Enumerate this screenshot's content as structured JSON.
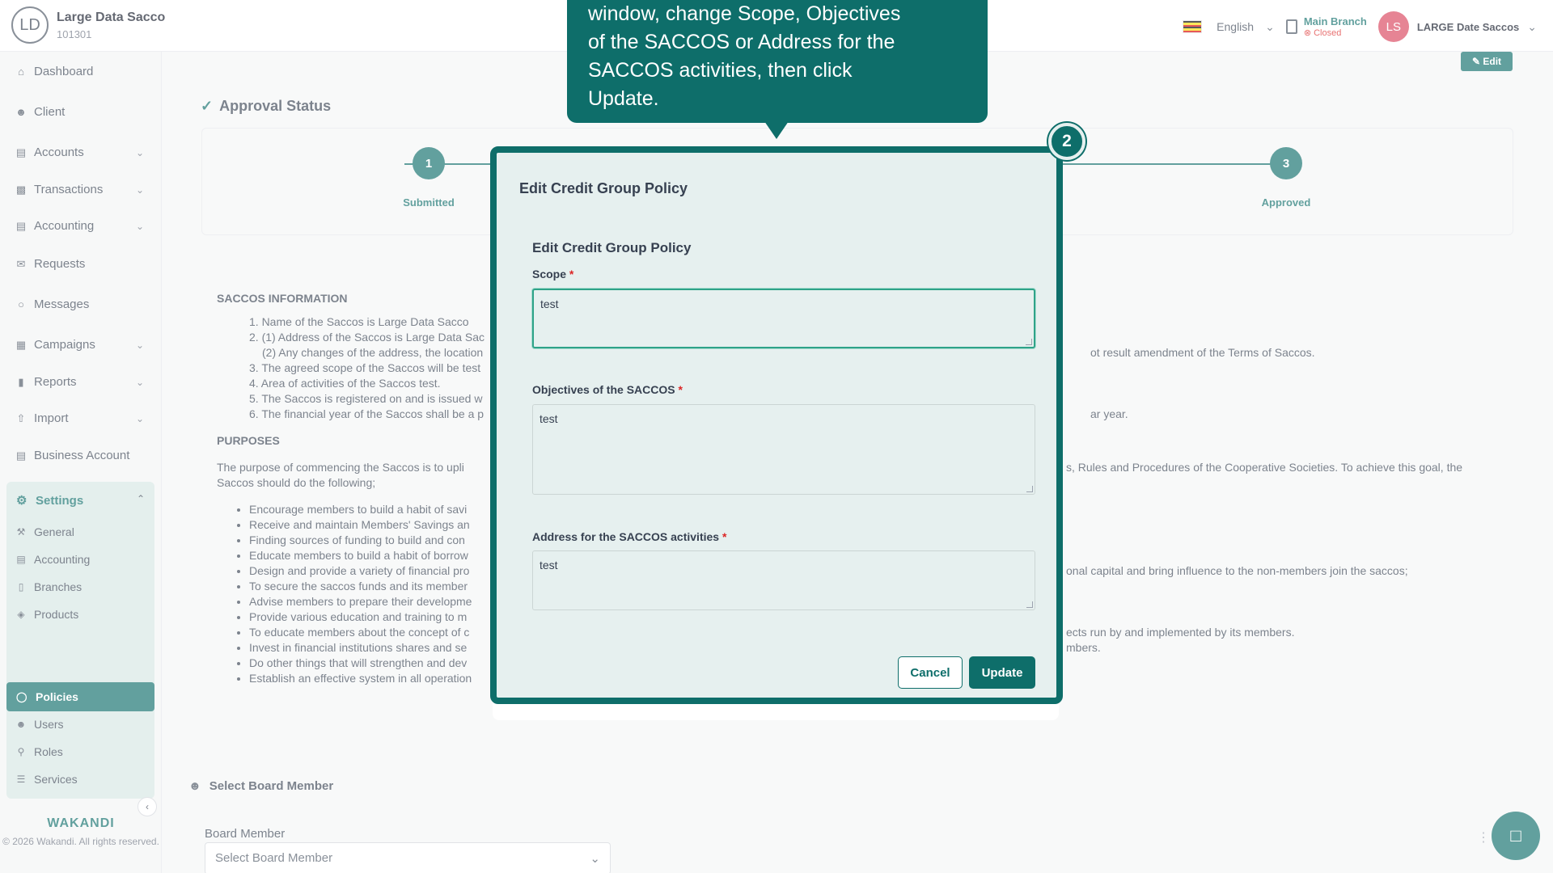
{
  "header": {
    "org_initials": "LD",
    "org_name": "Large Data Sacco",
    "org_code": "101301",
    "language": "English",
    "branch_name": "Main Branch",
    "branch_status": "Closed",
    "user_initials": "LS",
    "user_name": "LARGE Date Saccos"
  },
  "sidebar": {
    "items": [
      {
        "label": "Dashboard",
        "icon": "home-icon"
      },
      {
        "label": "Client",
        "icon": "user-icon"
      },
      {
        "label": "Accounts",
        "icon": "bank-icon"
      },
      {
        "label": "Transactions",
        "icon": "transactions-icon"
      },
      {
        "label": "Accounting",
        "icon": "ledger-icon"
      },
      {
        "label": "Requests",
        "icon": "mail-icon"
      },
      {
        "label": "Messages",
        "icon": "message-icon"
      },
      {
        "label": "Campaigns",
        "icon": "grid-icon"
      },
      {
        "label": "Reports",
        "icon": "chart-icon"
      },
      {
        "label": "Import",
        "icon": "upload-icon"
      },
      {
        "label": "Business Account",
        "icon": "bank-icon"
      }
    ],
    "settings_label": "Settings",
    "settings_items": [
      {
        "label": "General"
      },
      {
        "label": "Accounting"
      },
      {
        "label": "Branches"
      },
      {
        "label": "Products"
      },
      {
        "label": "Policies"
      },
      {
        "label": "Users"
      },
      {
        "label": "Roles"
      },
      {
        "label": "Services"
      }
    ],
    "brand": "WAKANDI",
    "copyright": "© 2026 Wakandi. All rights reserved."
  },
  "page": {
    "edit_label": "Edit",
    "approval_title": "Approval Status",
    "steps": [
      {
        "number": "1",
        "label": "Submitted"
      },
      {
        "number": "3",
        "label": "Approved"
      }
    ],
    "info_heading": "SACCOS INFORMATION",
    "info_items": [
      "1. Name of the Saccos is Large Data Sacco",
      "2. (1) Address of the Saccos is Large Data Sac",
      "(2) Any changes of the address, the location",
      "ot result amendment of the Terms of Saccos.",
      "3. The agreed scope of the Saccos will be test",
      "4. Area of activities of the Saccos test.",
      "5. The Saccos is registered on and is issued w",
      "6. The financial year of the Saccos shall be a p",
      "ar year."
    ],
    "purposes_heading": "PURPOSES",
    "purposes_intro_left": "The purpose of commencing the Saccos is to upli",
    "purposes_intro_right": "s, Rules and Procedures of the Cooperative Societies. To achieve this goal, the",
    "purposes_intro_2": "Saccos should do the following;",
    "purposes": [
      "Encourage members to build a habit of savi",
      "Receive and maintain Members' Savings an",
      "Finding sources of funding to build and con",
      "Educate members to build a habit of borrow",
      "Design and provide a variety of financial pro",
      "To secure the saccos funds and its member",
      "Advise members to prepare their developme",
      "Provide various education and training to m",
      "To educate members about the concept of c",
      "Invest in financial institutions shares and se",
      "Do other things that will strengthen and dev",
      "Establish an effective system in all operation"
    ],
    "purposes_right": [
      "onal capital and bring influence to the non-members join the saccos;",
      "ects run by and implemented by its members.",
      "mbers."
    ],
    "board_member_title": "Select Board Member",
    "board_member_label": "Board Member",
    "board_member_placeholder": "Select Board Member"
  },
  "tooltip": {
    "text_lines": [
      "window, change Scope, Objectives",
      "of the SACCOS or Address for the",
      "SACCOS activities, then click",
      "Update."
    ],
    "step_badge": "2"
  },
  "modal": {
    "title": "Edit Credit Group Policy",
    "subtitle": "Edit Credit Group Policy",
    "scope_label": "Scope",
    "scope_value": "test",
    "objectives_label": "Objectives of the SACCOS",
    "objectives_value": "test",
    "address_label": "Address for the SACCOS activities",
    "address_value": "test",
    "required_mark": "*",
    "cancel_label": "Cancel",
    "update_label": "Update"
  },
  "colors": {
    "brand": "#0e6e6a",
    "required": "#dc2626",
    "avatar": "#d9435b"
  }
}
